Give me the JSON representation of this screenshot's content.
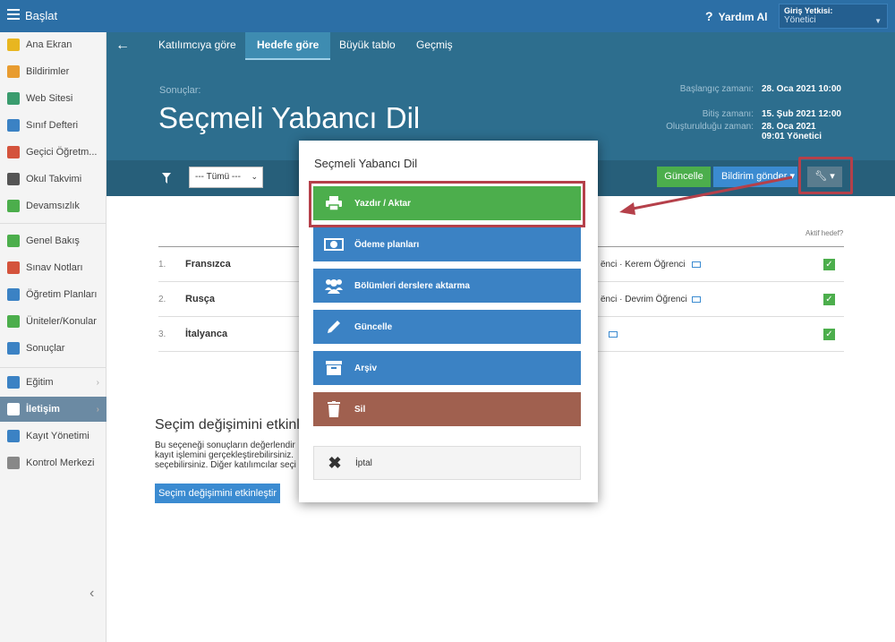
{
  "topbar": {
    "title": "Başlat",
    "help": "Yardım Al",
    "auth_label": "Giriş Yetkisi:",
    "auth_value": "Yönetici"
  },
  "sidebar": {
    "items": [
      {
        "label": "Ana Ekran",
        "color": "#e8b620"
      },
      {
        "label": "Bildirimler",
        "color": "#e89c30"
      },
      {
        "label": "Web Sitesi",
        "color": "#3a9c6e"
      },
      {
        "label": "Sınıf Defteri",
        "color": "#3b82c4"
      },
      {
        "label": "Geçici Öğretm...",
        "color": "#d4533c"
      },
      {
        "label": "Okul Takvimi",
        "color": "#555555"
      },
      {
        "label": "Devamsızlık",
        "color": "#4cae4c"
      },
      {
        "label": "Genel Bakış",
        "color": "#4cae4c"
      },
      {
        "label": "Sınav Notları",
        "color": "#d4533c"
      },
      {
        "label": "Öğretim Planları",
        "color": "#3b82c4"
      },
      {
        "label": "Üniteler/Konular",
        "color": "#4cae4c"
      },
      {
        "label": "Sonuçlar",
        "color": "#3b82c4"
      },
      {
        "label": "Eğitim",
        "color": "#3b82c4"
      },
      {
        "label": "İletişim",
        "color": "#ffffff"
      },
      {
        "label": "Kayıt Yönetimi",
        "color": "#3b82c4"
      },
      {
        "label": "Kontrol Merkezi",
        "color": "#888888"
      }
    ]
  },
  "tabs": [
    "Katılımcıya göre",
    "Hedefe göre",
    "Büyük tablo",
    "Geçmiş"
  ],
  "header": {
    "crumb": "Sonuçlar:",
    "title": "Seçmeli Yabancı Dil",
    "meta": [
      {
        "label": "Başlangıç zamanı:",
        "value": "28. Oca 2021 10:00"
      },
      {
        "label": "Bitiş zamanı:",
        "value": "15. Şub 2021 12:00"
      },
      {
        "label": "Oluşturulduğu zaman:",
        "value": "28. Oca 2021 09:01 Yönetici"
      }
    ]
  },
  "toolbar": {
    "filter": "--- Tümü ---",
    "update": "Güncelle",
    "notify": "Bildirim gönder"
  },
  "list": {
    "active_header": "Aktif hedef?",
    "rows": [
      {
        "num": "1.",
        "name": "Fransızca",
        "detail": "ënci · Kerem Öğrenci"
      },
      {
        "num": "2.",
        "name": "Rusça",
        "detail": "ënci · Devrim Öğrenci"
      },
      {
        "num": "3.",
        "name": "İtalyanca",
        "detail": ""
      }
    ]
  },
  "section": {
    "title": "Seçim değişimini etkinle",
    "text": "Bu seçeneği sonuçların değerlendir kayıt işlemini gerçekleştirebilirsiniz. seçebilirsiniz. Diğer katılımcılar seçi",
    "button": "Seçim değişimini etkinleştir"
  },
  "modal": {
    "title": "Seçmeli Yabancı Dil",
    "buttons": [
      {
        "label": "Yazdır / Aktar",
        "icon": "printer-icon"
      },
      {
        "label": "Ödeme planları",
        "icon": "money-icon"
      },
      {
        "label": "Bölümleri derslere aktarma",
        "icon": "users-icon"
      },
      {
        "label": "Güncelle",
        "icon": "pencil-icon"
      },
      {
        "label": "Arşiv",
        "icon": "archive-icon"
      },
      {
        "label": "Sil",
        "icon": "trash-icon"
      },
      {
        "label": "İptal",
        "icon": "close-icon"
      }
    ]
  }
}
